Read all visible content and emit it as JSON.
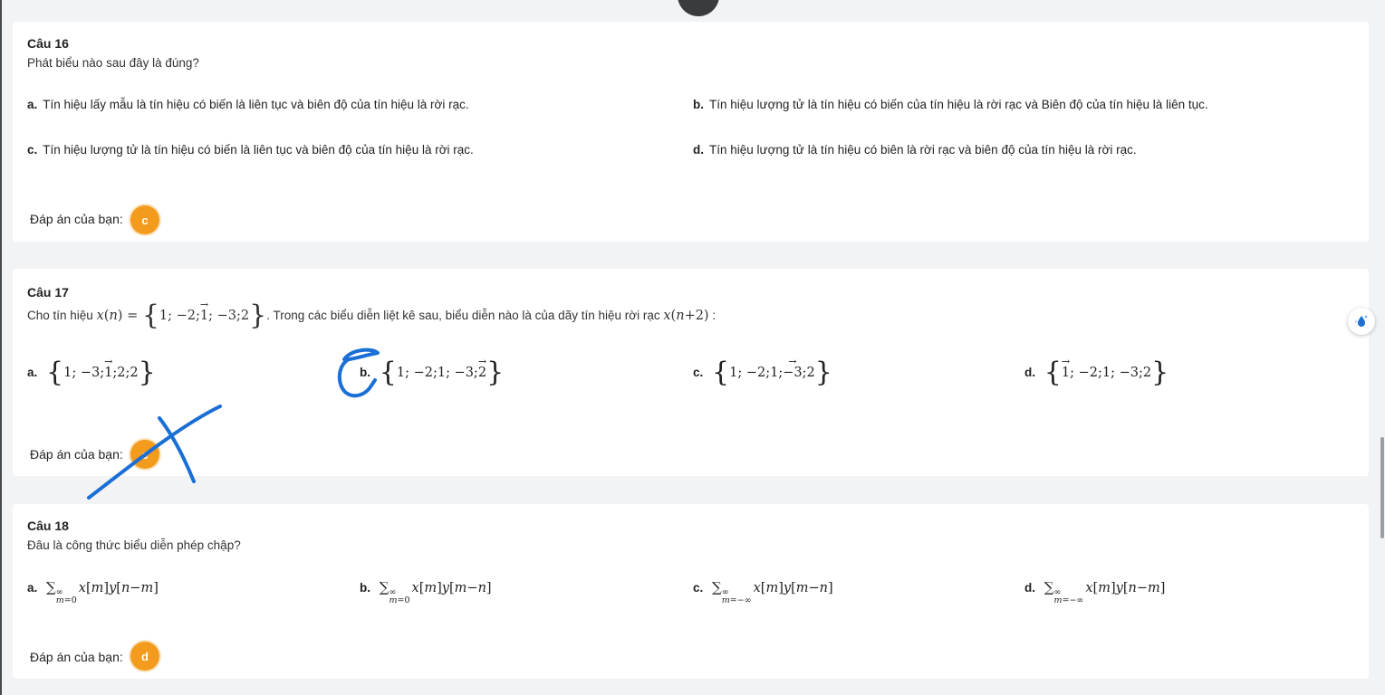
{
  "questions": [
    {
      "title": "Câu 16",
      "prompt": "Phát biểu nào sau đây là đúng?",
      "options": [
        {
          "key": "a.",
          "text": "Tín hiệu lấy mẫu là tín hiệu có biến là liên tục và biên độ của tín hiệu là rời rạc."
        },
        {
          "key": "b.",
          "text": "Tín hiệu lượng tử là tín hiệu có biến của tín hiệu là rời rạc và Biên độ của tín hiệu là liên tục."
        },
        {
          "key": "c.",
          "text": "Tín hiệu lượng tử là tín hiệu có biến là liên tục và biên độ của tín hiệu là rời rạc."
        },
        {
          "key": "d.",
          "text": "Tín hiệu lượng tử là tín hiệu có biên là rời rạc và biên độ của tín hiệu là rời rạc."
        }
      ],
      "answer_label": "Đáp án của bạn:",
      "answer": "c"
    },
    {
      "title": "Câu 17",
      "prompt_prefix": "Cho tín hiệu",
      "prompt_mid": ". Trong các biểu diễn liệt kê sau, biểu diễn nào là của dãy tín hiệu rời rạc",
      "prompt_suffix": ":",
      "options": [
        {
          "key": "a."
        },
        {
          "key": "b."
        },
        {
          "key": "c."
        },
        {
          "key": "d."
        }
      ],
      "answer_label": "Đáp án của bạn:",
      "answer": "c"
    },
    {
      "title": "Câu 18",
      "prompt": "Đâu là công thức biểu diễn phép chập?",
      "options": [
        {
          "key": "a."
        },
        {
          "key": "b."
        },
        {
          "key": "c."
        },
        {
          "key": "d."
        }
      ],
      "answer_label": "Đáp án của bạn:",
      "answer": "d"
    }
  ],
  "colors": {
    "badge": "#f29b1d",
    "annotation_pen": "#1a6fd6",
    "page_bg": "#f2f3f5",
    "card_bg": "#ffffff"
  },
  "icons": {
    "side_button": "sparkle-drop-icon"
  }
}
